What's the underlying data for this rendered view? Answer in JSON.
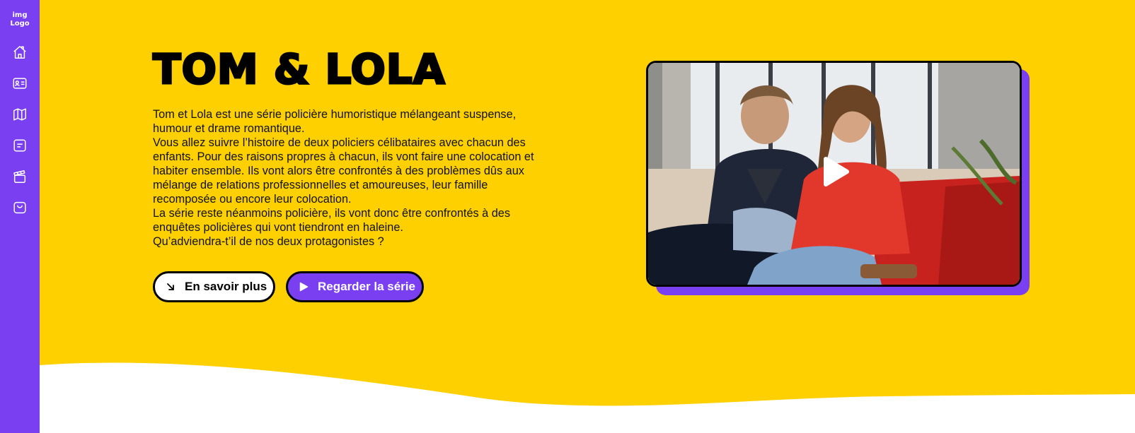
{
  "sidebar": {
    "logo_line1": "img",
    "logo_line2": "Logo",
    "icons": [
      "home-icon",
      "id-card-icon",
      "map-icon",
      "note-icon",
      "clapperboard-icon",
      "bag-icon"
    ]
  },
  "hero": {
    "title": "TOM & LOLA",
    "paragraphs": [
      "Tom et Lola est une série policière humoristique mélangeant suspense, humour et drame romantique.",
      "Vous allez suivre l’histoire de deux policiers célibataires avec chacun des enfants. Pour des raisons propres à chacun, ils vont faire une colocation et habiter ensemble. Ils vont alors être confrontés à des problèmes dûs aux mélange de relations professionnelles et amoureuses, leur famille recomposée ou encore leur colocation.",
      "La série reste néanmoins policière, ils vont donc être confrontés à des enquêtes policières qui vont tiendront en haleine.",
      "Qu’adviendra-t’il de nos deux protagonistes ?"
    ],
    "buttons": {
      "more_label": "En savoir plus",
      "watch_label": "Regarder la série"
    }
  },
  "colors": {
    "accent": "#7B3FF2",
    "background": "#FFD000",
    "text": "#000000"
  }
}
